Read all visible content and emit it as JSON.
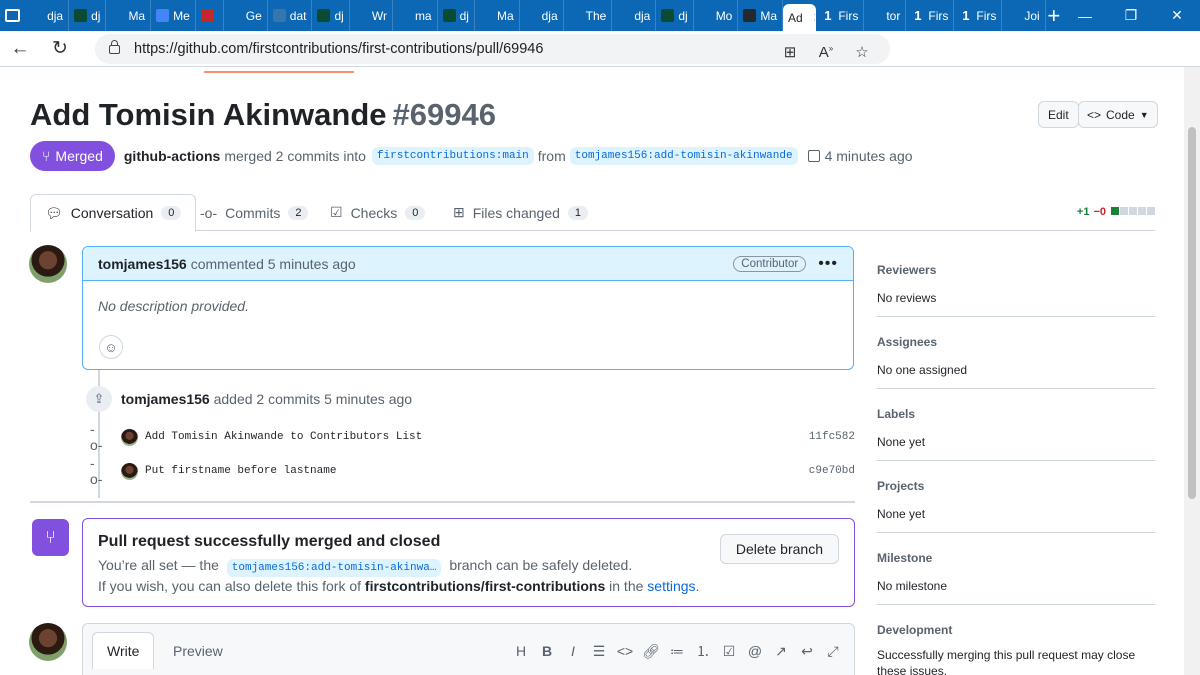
{
  "browser": {
    "tabs": [
      {
        "label": "dja",
        "icon": "search-icon",
        "color": "#0c67b4"
      },
      {
        "label": "dj",
        "icon": "dj-icon",
        "color": "#0c4b33"
      },
      {
        "label": "Ma",
        "icon": "search-icon",
        "color": "#0c67b4"
      },
      {
        "label": "Me",
        "icon": "doc-icon",
        "color": "#4285f4"
      },
      {
        "label": "",
        "icon": "red-icon",
        "color": "#c62828"
      },
      {
        "label": "Ge",
        "icon": "search-icon",
        "color": "#0c67b4"
      },
      {
        "label": "dat",
        "icon": "python-icon",
        "color": "#3776ab"
      },
      {
        "label": "dj",
        "icon": "dj-icon",
        "color": "#0c4b33"
      },
      {
        "label": "Wr",
        "icon": "search-icon",
        "color": "#0c67b4"
      },
      {
        "label": "ma",
        "icon": "search-icon",
        "color": "#0c67b4"
      },
      {
        "label": "dj",
        "icon": "dj-icon",
        "color": "#0c4b33"
      },
      {
        "label": "Ma",
        "icon": "search-icon",
        "color": "#0c67b4"
      },
      {
        "label": "dja",
        "icon": "search-icon",
        "color": "#0c67b4"
      },
      {
        "label": "The",
        "icon": "search-icon",
        "color": "#0c67b4"
      },
      {
        "label": "dja",
        "icon": "search-icon",
        "color": "#0c67b4"
      },
      {
        "label": "dj",
        "icon": "dj-icon",
        "color": "#0c4b33"
      },
      {
        "label": "Mo",
        "icon": "search-icon",
        "color": "#0c67b4"
      },
      {
        "label": "Ma",
        "icon": "github-icon",
        "color": "#24292f"
      }
    ],
    "active_tab": "Ad",
    "after_tabs": [
      {
        "label": "Firs",
        "icon": "one-icon",
        "glyph": "1"
      },
      {
        "label": "tor",
        "icon": "github-icon",
        "glyph": ""
      },
      {
        "label": "Firs",
        "icon": "one-icon",
        "glyph": "1"
      },
      {
        "label": "Firs",
        "icon": "one-icon",
        "glyph": "1"
      },
      {
        "label": "Joi",
        "icon": "slack-icon",
        "glyph": ""
      }
    ],
    "url": "https://github.com/firstcontributions/first-contributions/pull/69946"
  },
  "pr": {
    "title": "Add Tomisin Akinwande",
    "number": "#69946",
    "edit_label": "Edit",
    "code_label": "Code",
    "status_label": "Merged",
    "actor": "github-actions",
    "merged_text": "merged 2 commits into",
    "base_branch": "firstcontributions:main",
    "from_text": "from",
    "head_branch": "tomjames156:add-tomisin-akinwande",
    "time": "4 minutes ago"
  },
  "tabs": {
    "conversation": {
      "label": "Conversation",
      "count": "0"
    },
    "commits": {
      "label": "Commits",
      "count": "2"
    },
    "checks": {
      "label": "Checks",
      "count": "0"
    },
    "files": {
      "label": "Files changed",
      "count": "1"
    },
    "additions": "+1",
    "deletions": "−0"
  },
  "comment": {
    "author": "tomjames156",
    "action": "commented 5 minutes ago",
    "badge": "Contributor",
    "body": "No description provided."
  },
  "event": {
    "author": "tomjames156",
    "text": "added 2 commits 5 minutes ago"
  },
  "commits": [
    {
      "message": "Add Tomisin Akinwande to Contributors List",
      "sha": "11fc582"
    },
    {
      "message": "Put firstname before lastname",
      "sha": "c9e70bd"
    }
  ],
  "merge_box": {
    "title": "Pull request successfully merged and closed",
    "line1_pre": "You’re all set — the",
    "branch": "tomjames156:add-tomisin-akinwa…",
    "line1_post": "branch can be safely deleted.",
    "line2_pre": "If you wish, you can also delete this fork of",
    "repo": "firstcontributions/first-contributions",
    "line2_mid": "in the",
    "settings_link": "settings",
    "line2_end": ".",
    "delete_label": "Delete branch"
  },
  "editor": {
    "write_label": "Write",
    "preview_label": "Preview"
  },
  "sidebar": {
    "reviewers": {
      "title": "Reviewers",
      "value": "No reviews"
    },
    "assignees": {
      "title": "Assignees",
      "value": "No one assigned"
    },
    "labels": {
      "title": "Labels",
      "value": "None yet"
    },
    "projects": {
      "title": "Projects",
      "value": "None yet"
    },
    "milestone": {
      "title": "Milestone",
      "value": "No milestone"
    },
    "development": {
      "title": "Development",
      "value": "Successfully merging this pull request may close these issues."
    }
  }
}
